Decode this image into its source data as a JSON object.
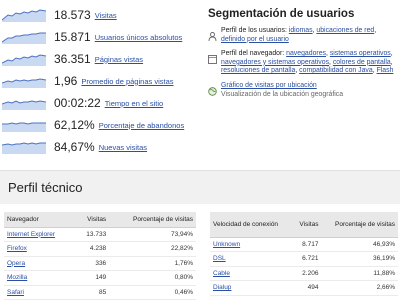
{
  "overview": {
    "metrics": [
      {
        "value": "18.573",
        "label": "Visitas"
      },
      {
        "value": "15.871",
        "label": "Usuarios únicos absolutos"
      },
      {
        "value": "36.351",
        "label": "Páginas vistas"
      },
      {
        "value": "1,96",
        "label": "Promedio de páginas vistas"
      },
      {
        "value": "00:02:22",
        "label": "Tiempo en el sitio"
      },
      {
        "value": "62,12%",
        "label": "Porcentaje de abandonos"
      },
      {
        "value": "84,67%",
        "label": "Nuevas visitas"
      }
    ]
  },
  "segmentation": {
    "title": "Segmentación de usuarios",
    "user_profile": {
      "prefix": "Perfil de los usuarios:",
      "links": [
        "idiomas",
        "ubicaciones de red",
        "definido por el usuario"
      ]
    },
    "browser_profile": {
      "prefix": "Perfil del navegador:",
      "links": [
        "navegadores",
        "sistemas operativos",
        "navegadores y sistemas operativos",
        "colores de pantalla",
        "resoluciones de pantalla",
        "compatibilidad con Java",
        "Flash"
      ]
    },
    "map": {
      "link": "Gráfico de visitas por ubicación",
      "sub": "Visualización de la ubicación geográfica"
    }
  },
  "tech_profile": {
    "title": "Perfil técnico",
    "browsers": {
      "headers": [
        "Navegador",
        "Visitas",
        "Porcentaje de visitas"
      ],
      "rows": [
        {
          "name": "Internet Explorer",
          "visits": "13.733",
          "pct": "73,94%"
        },
        {
          "name": "Firefox",
          "visits": "4.238",
          "pct": "22,82%"
        },
        {
          "name": "Opera",
          "visits": "336",
          "pct": "1,76%"
        },
        {
          "name": "Mozilla",
          "visits": "149",
          "pct": "0,80%"
        },
        {
          "name": "Safari",
          "visits": "85",
          "pct": "0,46%"
        }
      ]
    },
    "connections": {
      "headers": [
        "Velocidad de conexión",
        "Visitas",
        "Porcentaje de visitas"
      ],
      "rows": [
        {
          "name": "Unknown",
          "visits": "8.717",
          "pct": "46,93%"
        },
        {
          "name": "DSL",
          "visits": "6.721",
          "pct": "36,19%"
        },
        {
          "name": "Cable",
          "visits": "2.206",
          "pct": "11,88%"
        },
        {
          "name": "Dialup",
          "visits": "494",
          "pct": "2,66%"
        }
      ]
    }
  }
}
